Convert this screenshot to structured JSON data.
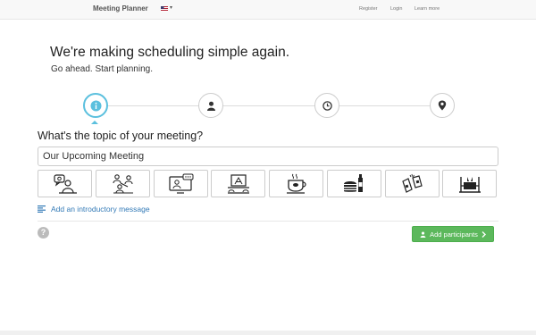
{
  "navbar": {
    "brand": "Meeting Planner",
    "links": [
      {
        "label": "Register"
      },
      {
        "label": "Login"
      },
      {
        "label": "Learn more"
      }
    ]
  },
  "hero": {
    "headline": "We're making scheduling simple again.",
    "subline": "Go ahead. Start planning."
  },
  "steps": [
    {
      "icon": "info-icon",
      "active": true
    },
    {
      "icon": "person-icon",
      "active": false
    },
    {
      "icon": "clock-icon",
      "active": false
    },
    {
      "icon": "map-marker-icon",
      "active": false
    }
  ],
  "form": {
    "question": "What's the topic of your meeting?",
    "subject_value": "Our Upcoming Meeting",
    "topics": [
      {
        "icon": "one-on-one-icon"
      },
      {
        "icon": "team-meeting-icon"
      },
      {
        "icon": "video-conference-icon"
      },
      {
        "icon": "presentation-icon"
      },
      {
        "icon": "coffee-icon"
      },
      {
        "icon": "lunch-icon"
      },
      {
        "icon": "drinks-icon"
      },
      {
        "icon": "dinner-icon"
      }
    ],
    "intro_link": "Add an introductory message",
    "add_participants": "Add participants"
  },
  "colors": {
    "accent": "#5bc0de",
    "link": "#337ab7",
    "success": "#5cb85c"
  }
}
